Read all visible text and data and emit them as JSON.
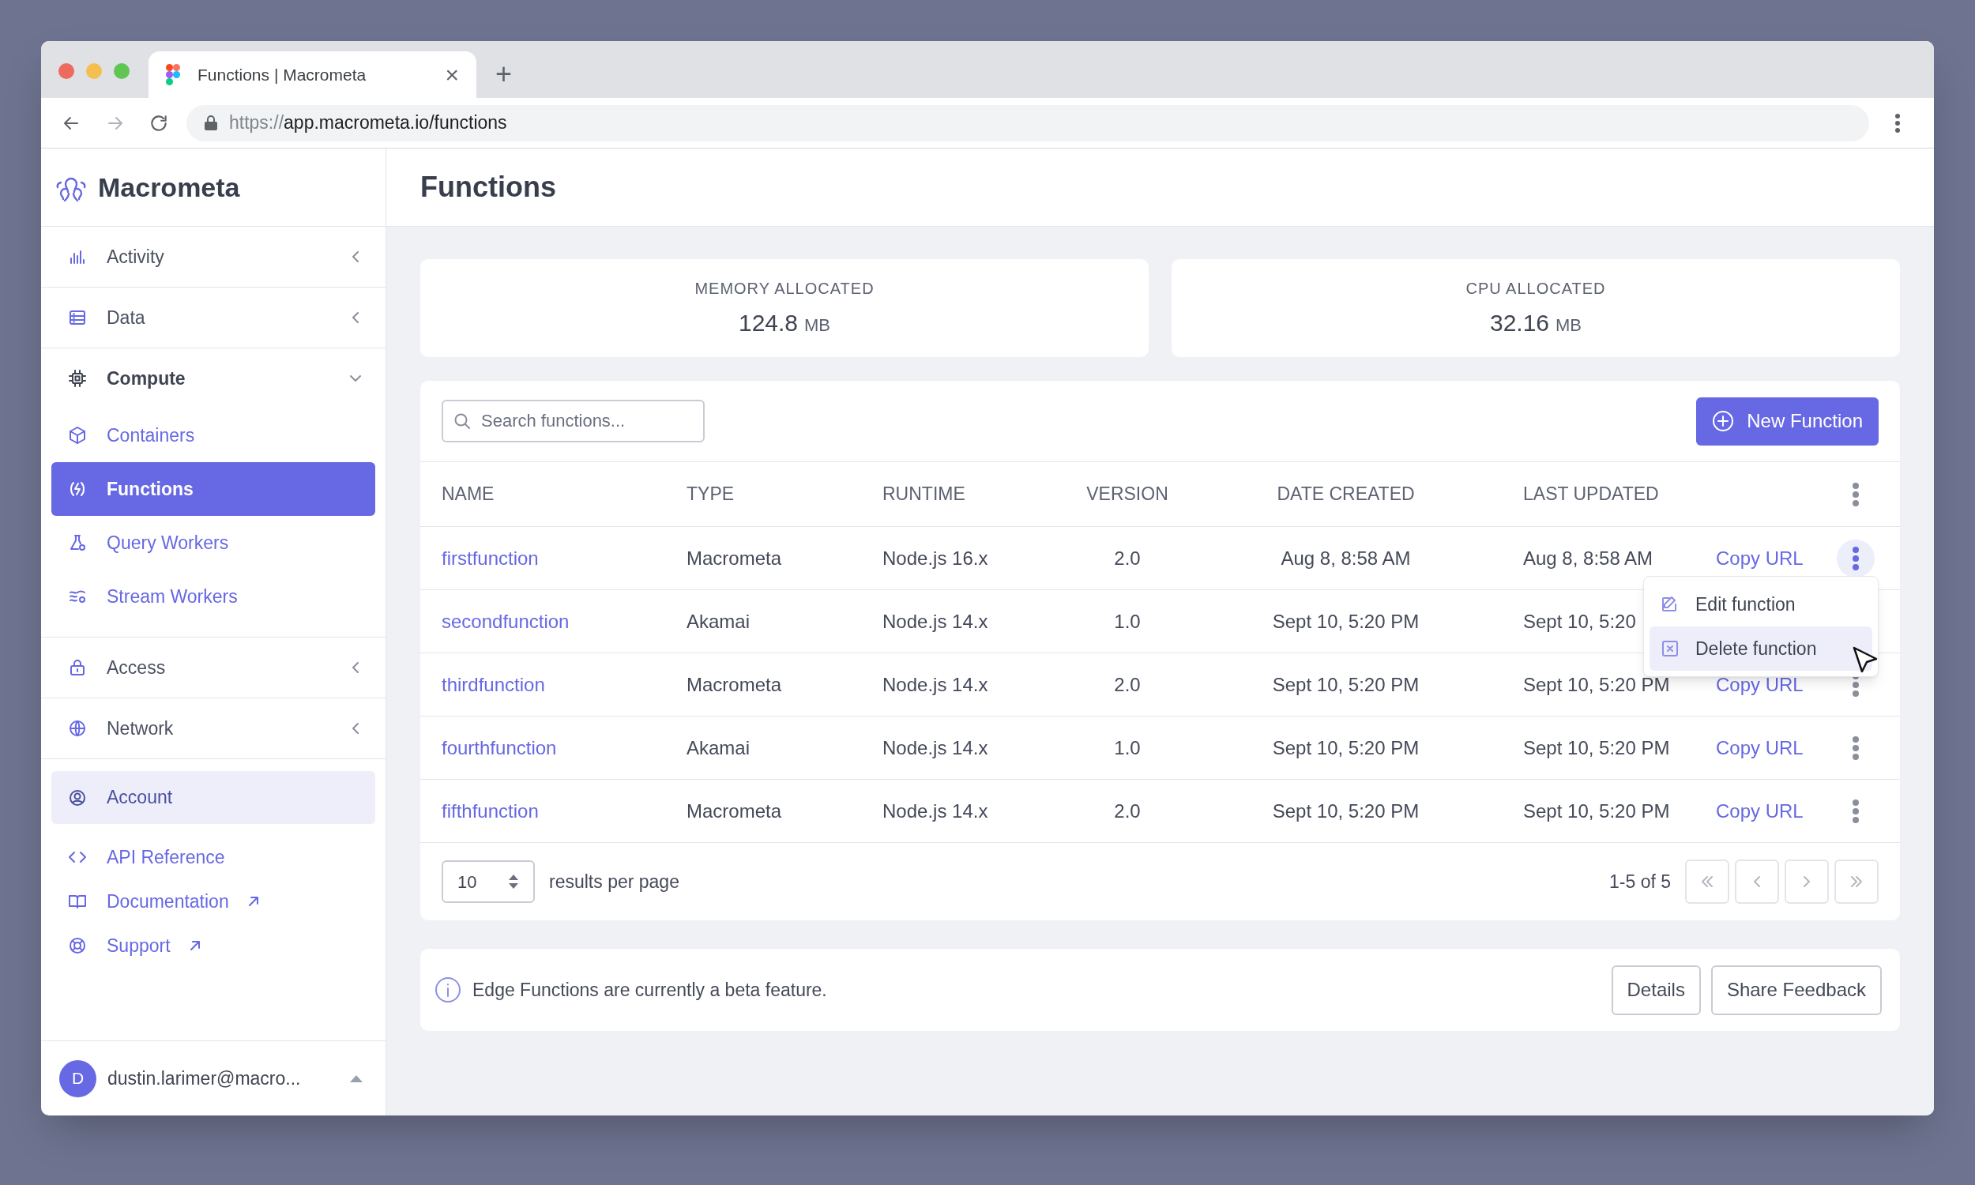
{
  "browser": {
    "tab_title": "Functions | Macrometa",
    "close": "×",
    "new_tab": "+",
    "url_scheme": "https://",
    "url_rest": "app.macrometa.io/functions"
  },
  "sidebar": {
    "brand": "Macrometa",
    "nav": [
      {
        "label": "Activity",
        "expanded": false
      },
      {
        "label": "Data",
        "expanded": false
      },
      {
        "label": "Compute",
        "expanded": true,
        "children": [
          {
            "label": "Containers",
            "selected": false
          },
          {
            "label": "Functions",
            "selected": true
          },
          {
            "label": "Query Workers",
            "selected": false
          },
          {
            "label": "Stream Workers",
            "selected": false
          }
        ]
      },
      {
        "label": "Access",
        "expanded": false
      },
      {
        "label": "Network",
        "expanded": false
      }
    ],
    "links": [
      {
        "label": "Account",
        "selected": true,
        "external": false
      },
      {
        "label": "API Reference",
        "selected": false,
        "external": false
      },
      {
        "label": "Documentation",
        "selected": false,
        "external": true
      },
      {
        "label": "Support",
        "selected": false,
        "external": true
      }
    ],
    "user": {
      "initial": "D",
      "email": "dustin.larimer@macro..."
    }
  },
  "page": {
    "title": "Functions"
  },
  "stats": [
    {
      "label": "MEMORY ALLOCATED",
      "value": "124.8",
      "unit": "MB"
    },
    {
      "label": "CPU ALLOCATED",
      "value": "32.16",
      "unit": "MB"
    }
  ],
  "toolbar": {
    "search_placeholder": "Search functions...",
    "new_button": "New Function"
  },
  "table": {
    "columns": [
      "NAME",
      "TYPE",
      "RUNTIME",
      "VERSION",
      "DATE CREATED",
      "LAST UPDATED"
    ],
    "rows": [
      {
        "name": "firstfunction",
        "type": "Macrometa",
        "runtime": "Node.js 16.x",
        "version": "2.0",
        "created": "Aug 8, 8:58 AM",
        "updated": "Aug 8, 8:58 AM",
        "copy_url": "Copy URL",
        "menu_open": true
      },
      {
        "name": "secondfunction",
        "type": "Akamai",
        "runtime": "Node.js 14.x",
        "version": "1.0",
        "created": "Sept 10, 5:20 PM",
        "updated": "Sept 10, 5:20",
        "menu_open": false
      },
      {
        "name": "thirdfunction",
        "type": "Macrometa",
        "runtime": "Node.js 14.x",
        "version": "2.0",
        "created": "Sept 10, 5:20 PM",
        "updated": "Sept 10, 5:20 PM",
        "copy_url": "Copy URL",
        "menu_open": false
      },
      {
        "name": "fourthfunction",
        "type": "Akamai",
        "runtime": "Node.js 14.x",
        "version": "1.0",
        "created": "Sept 10, 5:20 PM",
        "updated": "Sept 10, 5:20 PM",
        "copy_url": "Copy URL",
        "menu_open": false
      },
      {
        "name": "fifthfunction",
        "type": "Macrometa",
        "runtime": "Node.js 14.x",
        "version": "2.0",
        "created": "Sept 10, 5:20 PM",
        "updated": "Sept 10, 5:20 PM",
        "copy_url": "Copy URL",
        "menu_open": false
      }
    ]
  },
  "row_menu": [
    {
      "label": "Edit function",
      "selected": false
    },
    {
      "label": "Delete function",
      "selected": true
    }
  ],
  "pagination": {
    "per_page": "10",
    "per_page_label": "results per page",
    "range": "1-5 of 5"
  },
  "notice": {
    "text": "Edge Functions are currently a beta feature.",
    "buttons": [
      "Details",
      "Share Feedback"
    ]
  }
}
